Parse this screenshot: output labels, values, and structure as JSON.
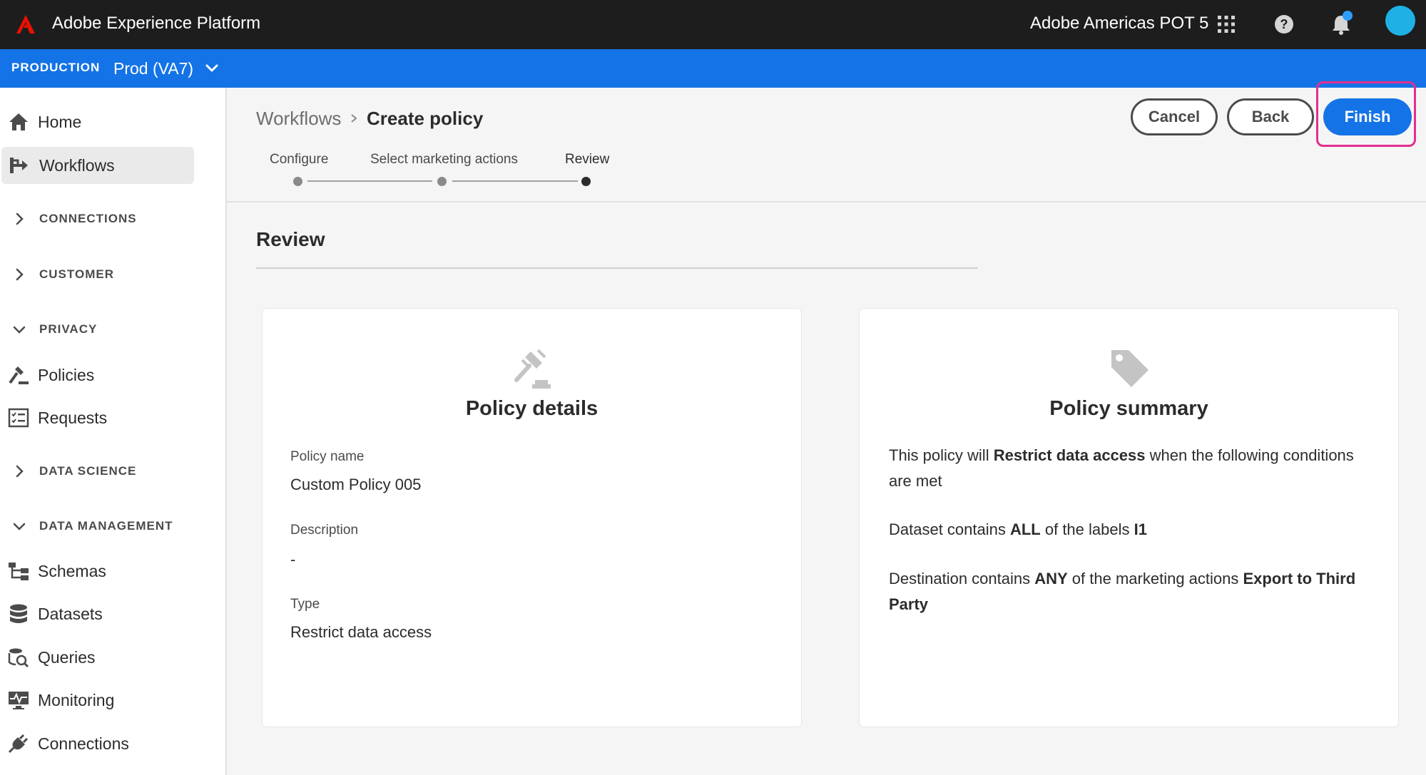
{
  "topbar": {
    "app_title": "Adobe Experience Platform",
    "org_name": "Adobe Americas POT 5",
    "icons": [
      "apps-grid-icon",
      "help-icon",
      "notifications-bell-icon",
      "avatar"
    ],
    "colors": {
      "background": "#1d1d1d",
      "logo": "#eb1000",
      "avatar": "#1fb1e6",
      "notification_badge": "#2d9dff"
    }
  },
  "sandbox": {
    "label": "PRODUCTION",
    "name": "Prod (VA7)",
    "color": "#1473e6"
  },
  "sidebar": {
    "home": "Home",
    "workflows": "Workflows",
    "connections_section": "CONNECTIONS",
    "customer_section": "CUSTOMER",
    "privacy_section": "PRIVACY",
    "policies": "Policies",
    "requests": "Requests",
    "data_science_section": "DATA SCIENCE",
    "data_management_section": "DATA MANAGEMENT",
    "schemas": "Schemas",
    "datasets": "Datasets",
    "queries": "Queries",
    "monitoring": "Monitoring",
    "connections": "Connections"
  },
  "breadcrumb": {
    "parent": "Workflows",
    "current": "Create policy"
  },
  "actions": {
    "cancel": "Cancel",
    "back": "Back",
    "finish": "Finish",
    "accent": "#1473e6",
    "highlight_color": "#e62e8f"
  },
  "stepper": {
    "steps": [
      "Configure",
      "Select marketing actions",
      "Review"
    ],
    "current_step": "Review"
  },
  "review": {
    "title": "Review"
  },
  "policy_details": {
    "title": "Policy details",
    "icon": "gavel-icon",
    "fields": {
      "name_label": "Policy name",
      "name_value": "Custom Policy 005",
      "description_label": "Description",
      "description_value": "-",
      "type_label": "Type",
      "type_value": "Restrict data access"
    }
  },
  "policy_summary": {
    "title": "Policy summary",
    "icon": "tag-icon",
    "line1": {
      "pre": "This policy will ",
      "bold": "Restrict data access",
      "post": " when the following conditions are met"
    },
    "line2": {
      "pre": "Dataset contains ",
      "bold1": "ALL",
      "mid": " of the labels ",
      "bold2": "I1"
    },
    "line3": {
      "pre": "Destination contains ",
      "bold1": "ANY",
      "mid": " of the marketing actions ",
      "bold2": "Export to Third Party"
    }
  }
}
